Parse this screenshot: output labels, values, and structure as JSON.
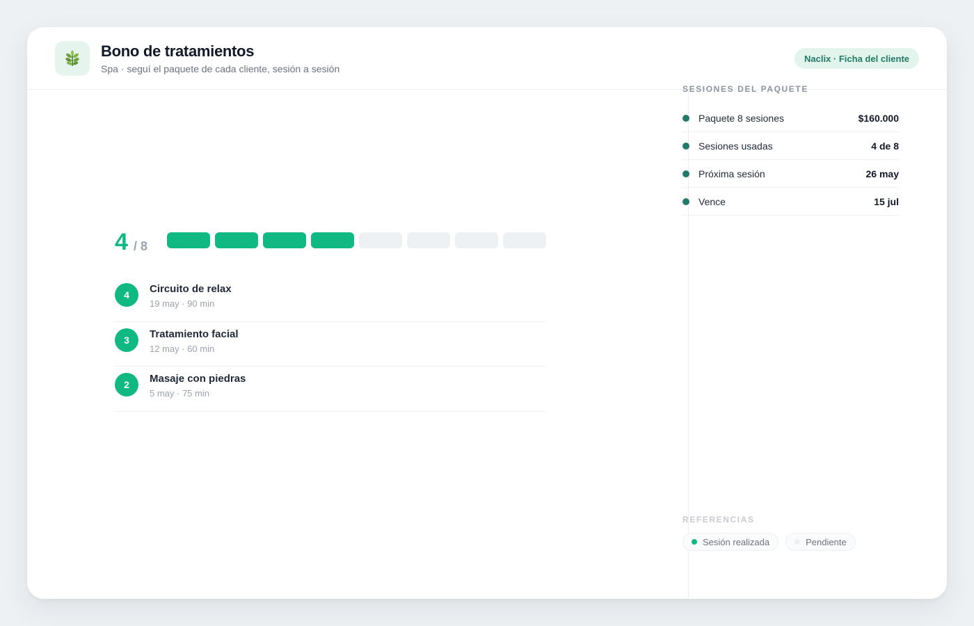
{
  "header": {
    "title": "Bono de tratamientos",
    "subtitle": "Spa · seguí el paquete de cada cliente, sesión a sesión",
    "badge": "Naclix · Ficha del cliente",
    "logo_icon": "leaf-icon"
  },
  "progress": {
    "used": "4",
    "total_label": "/ 8",
    "used_count": 4,
    "total_count": 8
  },
  "sessions": [
    {
      "number": "4",
      "name": "Circuito de relax",
      "meta": "19 may · 90 min"
    },
    {
      "number": "3",
      "name": "Tratamiento facial",
      "meta": "12 may · 60 min"
    },
    {
      "number": "2",
      "name": "Masaje con piedras",
      "meta": "5 may · 75 min"
    }
  ],
  "summary": {
    "title": "SESIONES DEL PAQUETE",
    "rows": [
      {
        "label": "Paquete 8 sesiones",
        "value": "$160.000"
      },
      {
        "label": "Sesiones usadas",
        "value": "4 de 8"
      },
      {
        "label": "Próxima sesión",
        "value": "26 may"
      },
      {
        "label": "Vence",
        "value": "15 jul"
      }
    ]
  },
  "legend": {
    "title": "REFERENCIAS",
    "done": "Sesión realizada",
    "pending": "Pendiente"
  },
  "colors": {
    "accent": "#10b981",
    "dot": "#227a6a",
    "pending": "#eef1f4"
  }
}
